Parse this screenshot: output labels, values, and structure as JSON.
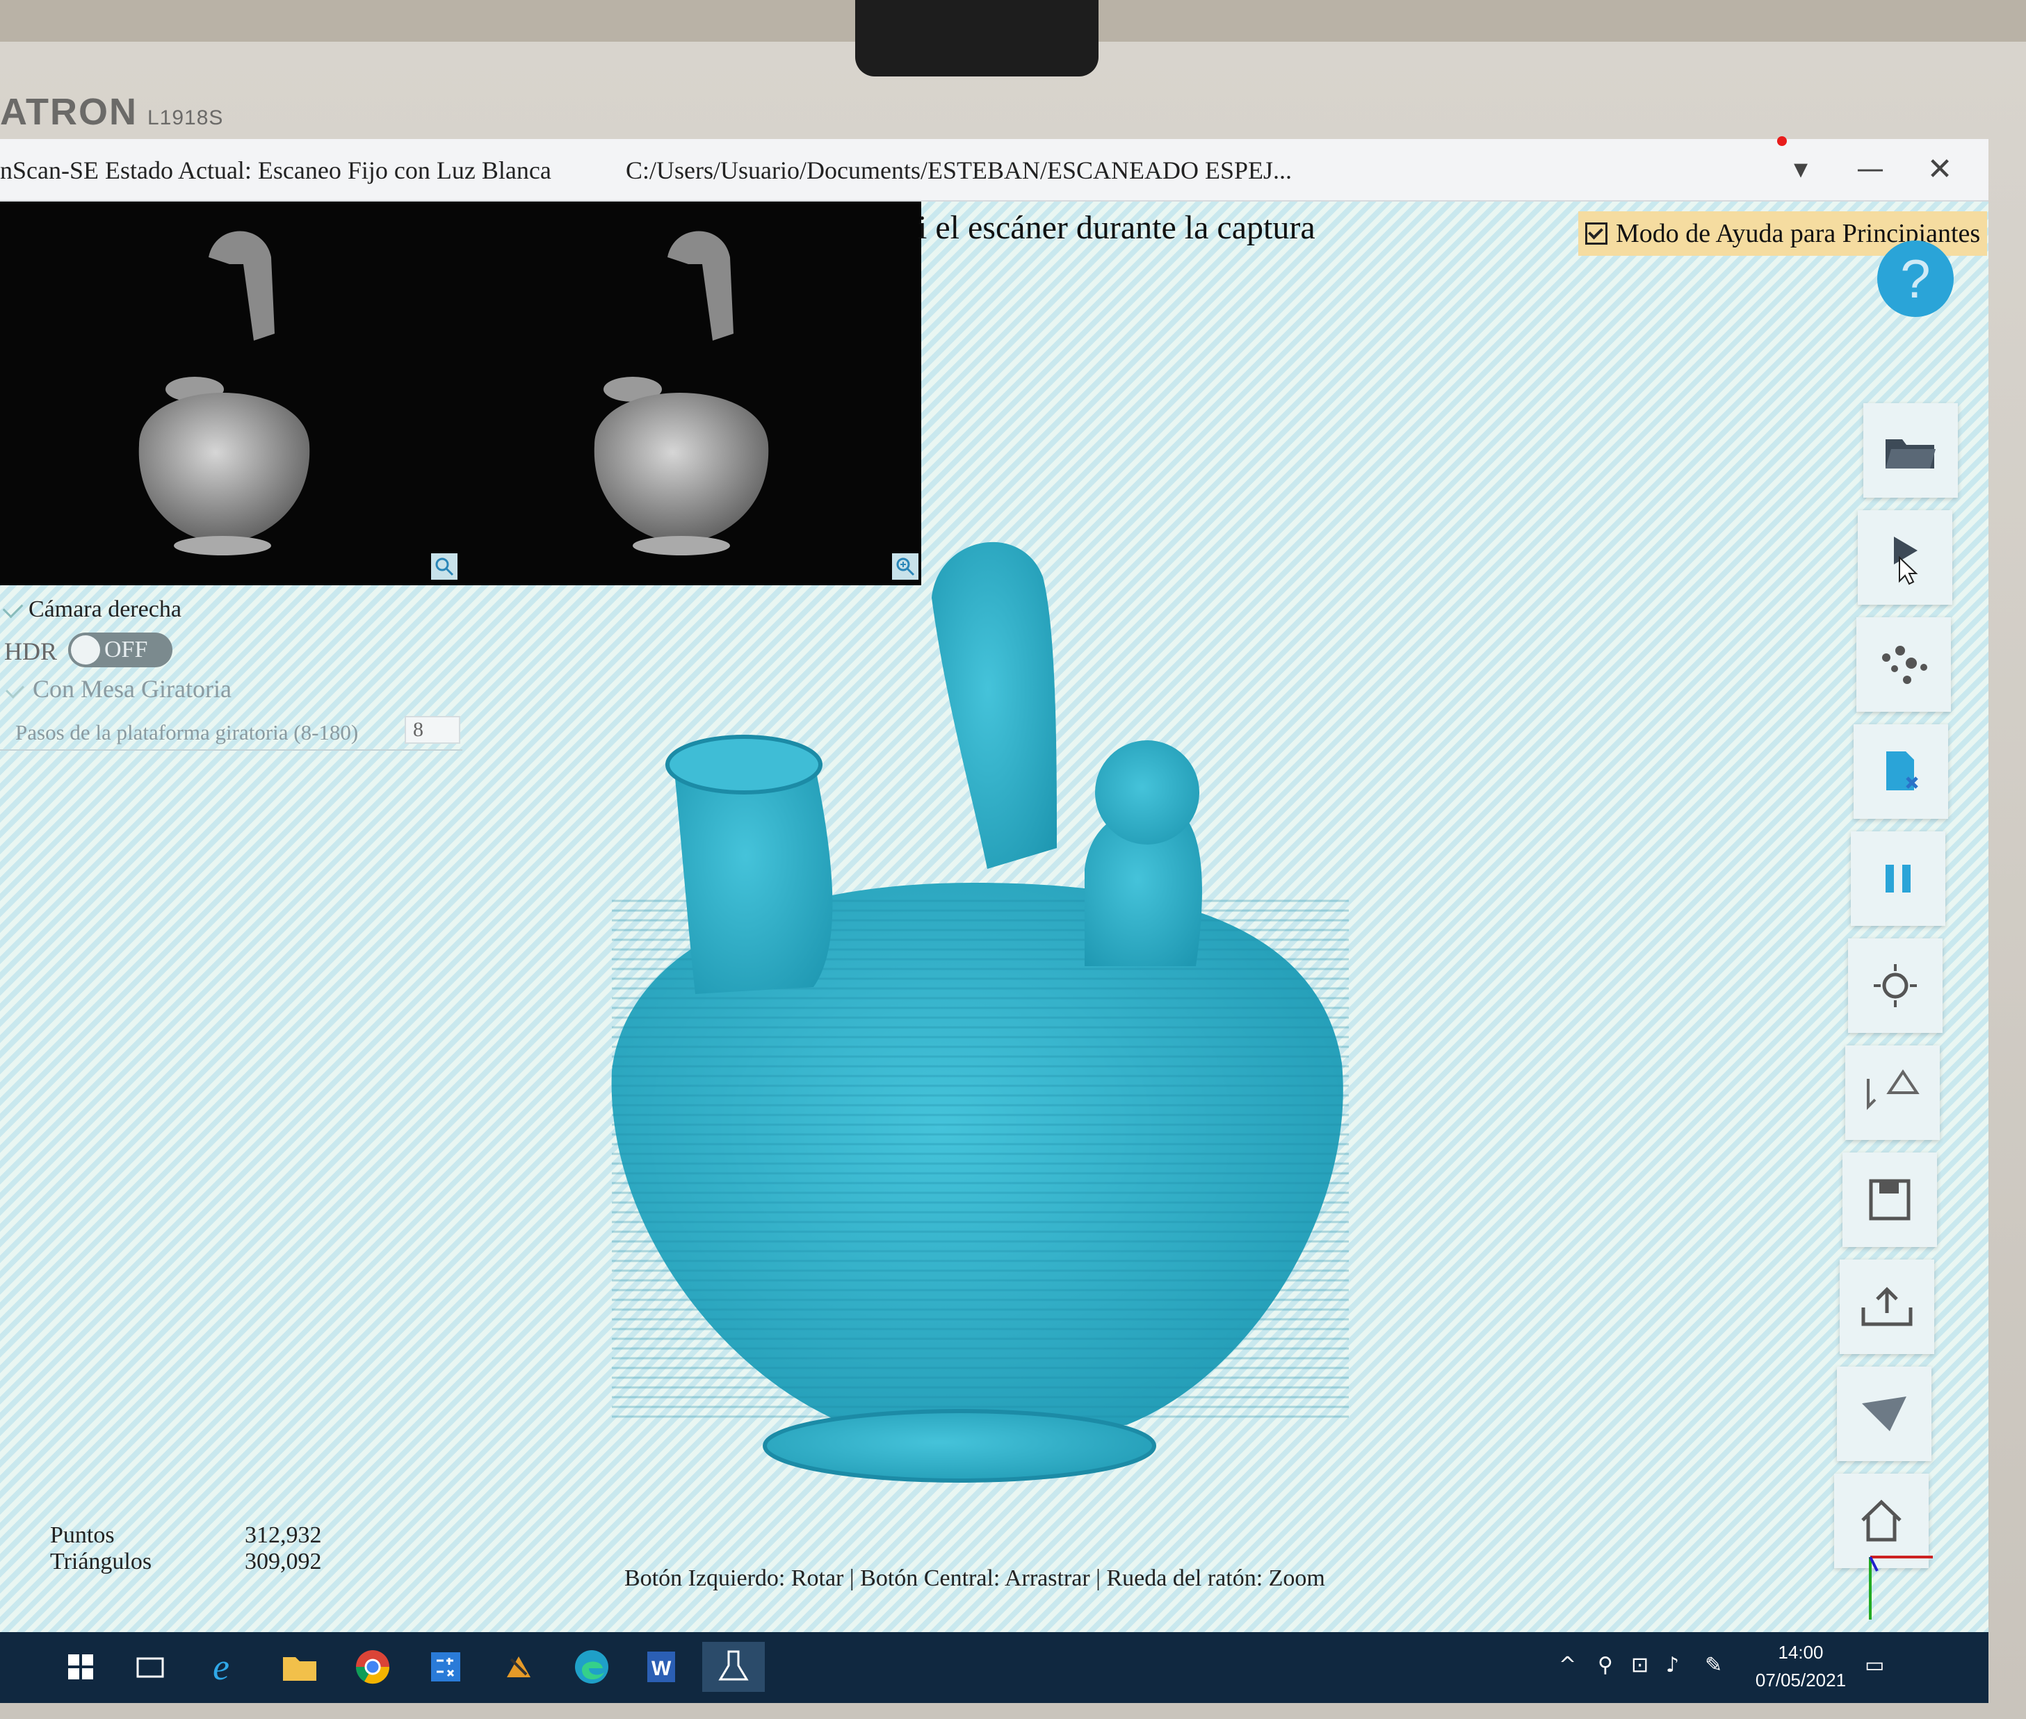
{
  "monitor": {
    "brand": "ATRON",
    "model": "L1918S"
  },
  "window": {
    "app_title": "nScan-SE Estado Actual: Escaneo Fijo con Luz Blanca",
    "file_path": "C:/Users/Usuario/Documents/ESTEBAN/ESCANEADO ESPEJ...",
    "controls": {
      "dropdown": "▾",
      "minimize": "—",
      "close": "✕"
    }
  },
  "viewport": {
    "instruction": "i el escáner durante la captura",
    "beginner_mode_label": "Modo de Ayuda para Principiantes",
    "beginner_mode_checked": true,
    "help_label": "?"
  },
  "camera_panel": {
    "right_camera_label": "Cámara derecha",
    "hdr_label": "HDR",
    "hdr_state": "OFF",
    "turntable_label": "Con Mesa Giratoria",
    "steps_label": "Pasos de la plataforma giratoria (8-180)",
    "steps_value": "8"
  },
  "toolbar": {
    "items": [
      "open-folder",
      "start-scan",
      "point-cloud",
      "delete-data",
      "pause",
      "brightness",
      "align",
      "save",
      "export",
      "measure",
      "home"
    ]
  },
  "stats": {
    "points_label": "Puntos",
    "points_value": "312,932",
    "triangles_label": "Triángulos",
    "triangles_value": "309,092"
  },
  "mouse_hint": "Botón Izquierdo: Rotar | Botón Central: Arrastrar | Rueda del ratón: Zoom",
  "taskbar": {
    "apps": [
      "windows-start",
      "task-view",
      "internet-explorer",
      "file-explorer",
      "chrome",
      "calculator",
      "miner-app",
      "edge",
      "word",
      "scanner-app"
    ],
    "time": "14:00",
    "date": "07/05/2021"
  },
  "colors": {
    "scan_model": "#2fb6d0",
    "help_button": "#2aa4d8",
    "beginner_highlight": "#f5dca0",
    "taskbar": "#102840"
  }
}
